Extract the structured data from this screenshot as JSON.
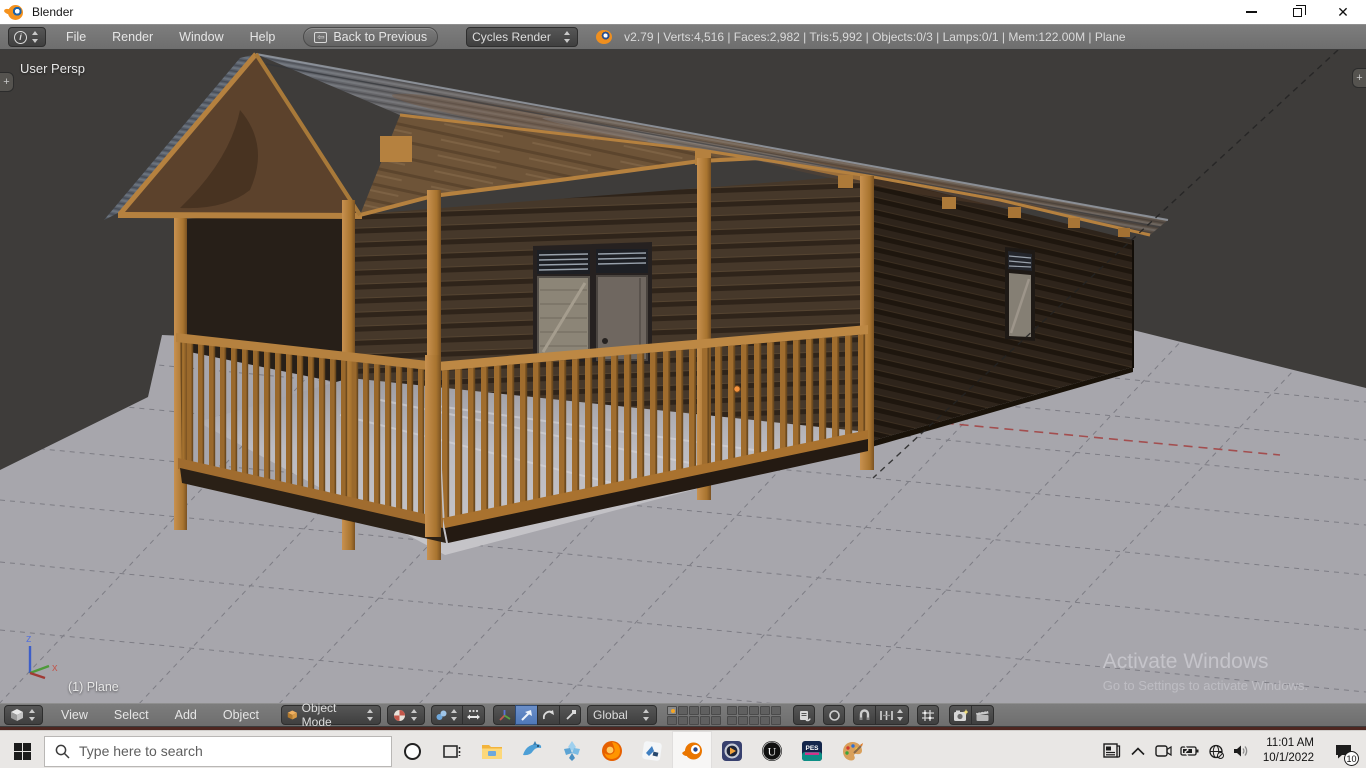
{
  "window": {
    "title": "Blender",
    "controls": [
      "minimize-icon",
      "restore-icon",
      "close-icon"
    ]
  },
  "info_header": {
    "editor_icon": "info-editor-icon",
    "menus": [
      "File",
      "Render",
      "Window",
      "Help"
    ],
    "back_button": "Back to Previous",
    "engine_select": "Cycles Render",
    "logo_icon": "blender-logo-icon",
    "stats": "v2.79 | Verts:4,516 | Faces:2,982 | Tris:5,992 | Objects:0/3 | Lamps:0/1 | Mem:122.00M | Plane"
  },
  "viewport": {
    "view_label": "User Persp",
    "object_label": "(1) Plane",
    "axis_z": "z",
    "axis_x": "x",
    "add_region_tab": "+",
    "watermark_title": "Activate Windows",
    "watermark_subtitle": "Go to Settings to activate Windows."
  },
  "view3d_header": {
    "editor_icon": "3d-view-editor-icon",
    "menus": [
      "View",
      "Select",
      "Add",
      "Object"
    ],
    "mode_select": "Object Mode",
    "orientation_select": "Global",
    "icons": [
      "viewport-shading-icon",
      "pivot-point-icon",
      "manipulator-center-icon",
      "manipulator-axes-icon",
      "translate-manipulator-icon",
      "rotate-manipulator-icon",
      "scale-manipulator-icon",
      "layers-grid",
      "scene-lock-icon",
      "proportional-edit-icon",
      "snap-magnet-icon",
      "snap-increment-icon",
      "snap-grid-icon",
      "opengl-render-icon",
      "opengl-animation-icon"
    ]
  },
  "taskbar": {
    "search_placeholder": "Type here to search",
    "icons": [
      "start-icon",
      "search-icon",
      "cortana-icon",
      "task-view-icon",
      "file-explorer-icon",
      "dolphin-icon",
      "ppsspp-icon",
      "firefox-icon",
      "threeds-app-icon",
      "blender-icon",
      "media-player-icon",
      "unreal-engine-icon",
      "pes2021-icon",
      "paint-icon"
    ],
    "tray_icons": [
      "news-icon",
      "chevron-up-icon",
      "meet-now-icon",
      "battery-icon",
      "network-globe-icon",
      "speaker-icon",
      "notification-icon"
    ],
    "clock_time": "11:01 AM",
    "clock_date": "10/1/2022",
    "notification_count": "10"
  },
  "colors": {
    "accent_blue": "#0078d7",
    "header_gray": "#727272",
    "viewport_bg": "#3e3c3a",
    "ground_gray": "#a7a6ac",
    "wood_frame": "#b5813f",
    "wall_dark": "#2f251c",
    "active_manipulator": "#5680c2",
    "selection_orange": "#f5a623",
    "axis_red": "#a34545"
  }
}
